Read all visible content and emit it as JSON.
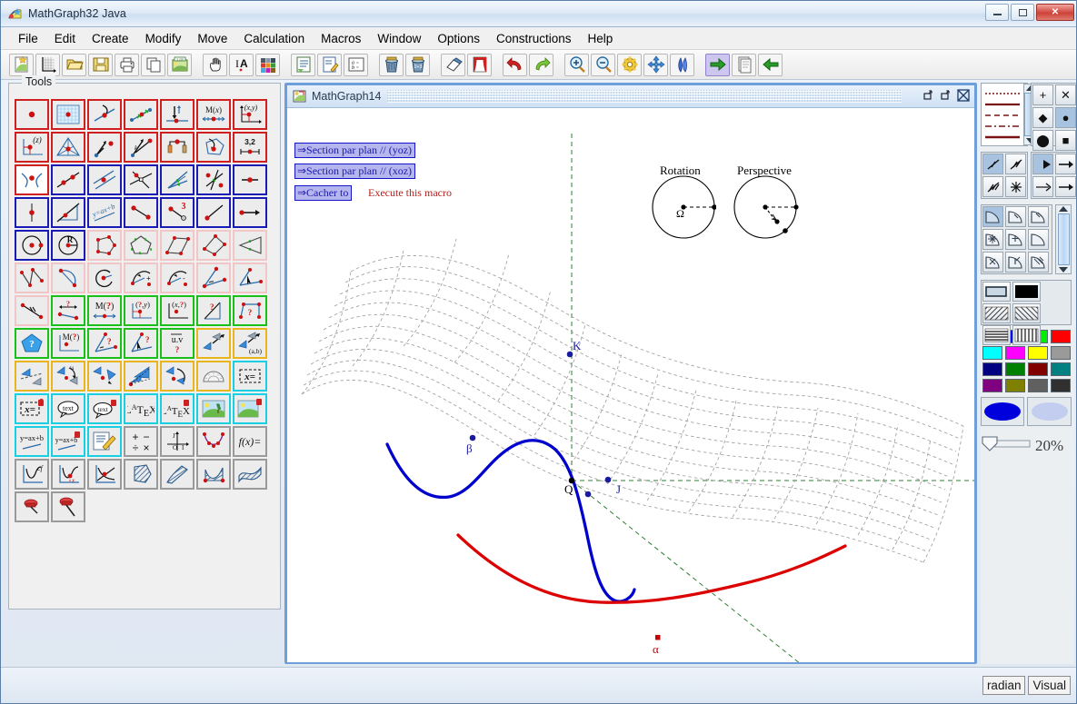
{
  "window": {
    "title": "MathGraph32 Java",
    "icon": "app-icon",
    "minimize": "–",
    "maximize": "□",
    "close": "✕"
  },
  "menubar": {
    "items": [
      {
        "label": "File"
      },
      {
        "label": "Edit"
      },
      {
        "label": "Create"
      },
      {
        "label": "Modify"
      },
      {
        "label": "Move"
      },
      {
        "label": "Calculation"
      },
      {
        "label": "Macros"
      },
      {
        "label": "Window"
      },
      {
        "label": "Options"
      },
      {
        "label": "Constructions"
      },
      {
        "label": "Help"
      }
    ]
  },
  "toolbar": {
    "groups": [
      {
        "buttons": [
          {
            "name": "new-document-icon",
            "selected": false
          },
          {
            "name": "new-graph-icon",
            "selected": false
          },
          {
            "name": "open-folder-icon",
            "selected": false
          },
          {
            "name": "save-floppy-icon",
            "selected": false
          },
          {
            "name": "print-icon",
            "selected": false
          },
          {
            "name": "copy-icon",
            "selected": false
          },
          {
            "name": "export-image-icon",
            "selected": false
          }
        ]
      },
      {
        "buttons": [
          {
            "name": "hand-pan-icon",
            "selected": false
          },
          {
            "name": "text-cursor-icon",
            "selected": false
          },
          {
            "name": "color-palette-icon",
            "selected": false
          }
        ]
      },
      {
        "buttons": [
          {
            "name": "document-list-icon",
            "selected": false
          },
          {
            "name": "edit-note-icon",
            "selected": false
          },
          {
            "name": "formula-abc-icon",
            "selected": false
          }
        ]
      },
      {
        "buttons": [
          {
            "name": "trash-icon",
            "selected": false
          },
          {
            "name": "trash-calc-icon",
            "selected": false
          }
        ]
      },
      {
        "buttons": [
          {
            "name": "eraser-icon",
            "selected": false
          },
          {
            "name": "curtain-icon",
            "selected": false
          }
        ]
      },
      {
        "buttons": [
          {
            "name": "undo-icon",
            "selected": false
          },
          {
            "name": "redo-icon",
            "selected": false
          }
        ]
      },
      {
        "buttons": [
          {
            "name": "zoom-in-icon",
            "selected": false
          },
          {
            "name": "zoom-out-icon",
            "selected": false
          },
          {
            "name": "gear-settings-icon",
            "selected": false
          },
          {
            "name": "move-arrows-icon",
            "selected": false
          },
          {
            "name": "reflect-icon",
            "selected": false
          }
        ]
      },
      {
        "buttons": [
          {
            "name": "step-forward-icon",
            "selected": true
          },
          {
            "name": "pages-icon",
            "selected": false
          },
          {
            "name": "step-back-icon",
            "selected": false
          }
        ]
      }
    ]
  },
  "tools": {
    "legend": "Tools",
    "cells": [
      {
        "name": "tool-free-point",
        "family": "red",
        "selected": false
      },
      {
        "name": "tool-point-on-grid",
        "family": "red",
        "selected": false
      },
      {
        "name": "tool-point-on-line",
        "family": "red",
        "selected": false
      },
      {
        "name": "tool-point-on-segment",
        "family": "red",
        "selected": false
      },
      {
        "name": "tool-point-projection",
        "family": "red",
        "selected": false
      },
      {
        "name": "tool-point-m-of-x",
        "family": "red",
        "selected": false
      },
      {
        "name": "tool-point-xy",
        "family": "red",
        "selected": false
      },
      {
        "name": "tool-point-z",
        "family": "red",
        "selected": false
      },
      {
        "name": "tool-barycenter",
        "family": "red",
        "selected": false
      },
      {
        "name": "tool-vector-point",
        "family": "red",
        "selected": false
      },
      {
        "name": "tool-vector-k",
        "family": "red",
        "selected": false
      },
      {
        "name": "tool-point-between",
        "family": "red",
        "selected": false
      },
      {
        "name": "tool-point-in-polygon",
        "family": "red",
        "selected": false
      },
      {
        "name": "tool-point-coords-32",
        "family": "red",
        "selected": false
      },
      {
        "name": "tool-intersection",
        "family": "red",
        "selected": true
      },
      {
        "name": "tool-line-two-points",
        "family": "blue",
        "selected": false
      },
      {
        "name": "tool-parallel-line",
        "family": "blue",
        "selected": false
      },
      {
        "name": "tool-perpendicular-line",
        "family": "blue",
        "selected": false
      },
      {
        "name": "tool-angle-bisector",
        "family": "blue",
        "selected": false
      },
      {
        "name": "tool-perp-bisector",
        "family": "blue",
        "selected": false
      },
      {
        "name": "tool-segment",
        "family": "blue",
        "selected": false
      },
      {
        "name": "tool-vertical-line",
        "family": "blue",
        "selected": false
      },
      {
        "name": "tool-ray",
        "family": "blue",
        "selected": false
      },
      {
        "name": "tool-line-y-ax-b",
        "family": "blue",
        "selected": false
      },
      {
        "name": "tool-segment-two-pts",
        "family": "blue",
        "selected": false
      },
      {
        "name": "tool-segment-length-3",
        "family": "blue",
        "selected": false
      },
      {
        "name": "tool-half-line",
        "family": "blue",
        "selected": false
      },
      {
        "name": "tool-vector-arrow",
        "family": "blue",
        "selected": false
      },
      {
        "name": "tool-circle-center-point",
        "family": "blue",
        "selected": false
      },
      {
        "name": "tool-circle-radius",
        "family": "blue",
        "selected": false
      },
      {
        "name": "tool-polygon",
        "family": "pink",
        "selected": false
      },
      {
        "name": "tool-regular-polygon",
        "family": "pink",
        "selected": false
      },
      {
        "name": "tool-parallelogram",
        "family": "pink",
        "selected": false
      },
      {
        "name": "tool-square",
        "family": "pink",
        "selected": false
      },
      {
        "name": "tool-isosceles-triangle",
        "family": "pink",
        "selected": false
      },
      {
        "name": "tool-broken-line",
        "family": "pink",
        "selected": false
      },
      {
        "name": "tool-circle-arc-chord",
        "family": "pink",
        "selected": false
      },
      {
        "name": "tool-arc-center",
        "family": "pink",
        "selected": false
      },
      {
        "name": "tool-arc-plus",
        "family": "pink",
        "selected": false
      },
      {
        "name": "tool-arc-minus",
        "family": "pink",
        "selected": false
      },
      {
        "name": "tool-angle-mark",
        "family": "pink",
        "selected": false
      },
      {
        "name": "tool-angle-pick",
        "family": "pink",
        "selected": false
      },
      {
        "name": "tool-tick-mark",
        "family": "pink",
        "selected": false
      },
      {
        "name": "tool-measure-length",
        "family": "green",
        "selected": false
      },
      {
        "name": "tool-measure-m-question",
        "family": "green",
        "selected": false
      },
      {
        "name": "tool-measure-y",
        "family": "green",
        "selected": false
      },
      {
        "name": "tool-measure-x",
        "family": "green",
        "selected": false
      },
      {
        "name": "tool-measure-slope",
        "family": "green",
        "selected": false
      },
      {
        "name": "tool-measure-area",
        "family": "green",
        "selected": false
      },
      {
        "name": "tool-polygon-question",
        "family": "green",
        "selected": false
      },
      {
        "name": "tool-point-m-question",
        "family": "green",
        "selected": false
      },
      {
        "name": "tool-angle-question",
        "family": "green",
        "selected": false
      },
      {
        "name": "tool-angle-pick-question",
        "family": "green",
        "selected": false
      },
      {
        "name": "tool-dot-product",
        "family": "green",
        "selected": false
      },
      {
        "name": "tool-translation",
        "family": "gold",
        "selected": false
      },
      {
        "name": "tool-translation-ab",
        "family": "gold",
        "selected": false
      },
      {
        "name": "tool-reflection-line",
        "family": "gold",
        "selected": false
      },
      {
        "name": "tool-rotation-quarter",
        "family": "gold",
        "selected": false
      },
      {
        "name": "tool-point-symmetry",
        "family": "gold",
        "selected": false
      },
      {
        "name": "tool-homothety",
        "family": "gold",
        "selected": false
      },
      {
        "name": "tool-rotation",
        "family": "gold",
        "selected": false
      },
      {
        "name": "tool-protractor",
        "family": "gold",
        "selected": false
      },
      {
        "name": "tool-display-value",
        "family": "cyan",
        "selected": false
      },
      {
        "name": "tool-display-value-locked",
        "family": "cyan",
        "selected": false
      },
      {
        "name": "tool-text",
        "family": "cyan",
        "selected": false
      },
      {
        "name": "tool-text-locked",
        "family": "cyan",
        "selected": false
      },
      {
        "name": "tool-latex",
        "family": "cyan",
        "selected": false
      },
      {
        "name": "tool-latex-locked",
        "family": "cyan",
        "selected": false
      },
      {
        "name": "tool-image",
        "family": "cyan",
        "selected": false
      },
      {
        "name": "tool-image-locked",
        "family": "cyan",
        "selected": false
      },
      {
        "name": "tool-linear-function",
        "family": "cyan",
        "selected": false
      },
      {
        "name": "tool-linear-function-locked",
        "family": "cyan",
        "selected": false
      },
      {
        "name": "tool-edit-note",
        "family": "cyan",
        "selected": false
      },
      {
        "name": "tool-operations",
        "family": "gray",
        "selected": false
      },
      {
        "name": "tool-axes",
        "family": "gray",
        "selected": false
      },
      {
        "name": "tool-point-series",
        "family": "gray",
        "selected": false
      },
      {
        "name": "tool-function-fx",
        "family": "gray",
        "selected": false
      },
      {
        "name": "tool-curve-plot",
        "family": "gray",
        "selected": false
      },
      {
        "name": "tool-curve-point",
        "family": "gray",
        "selected": false
      },
      {
        "name": "tool-tangent",
        "family": "gray",
        "selected": false
      },
      {
        "name": "tool-fill-polygon",
        "family": "gray",
        "selected": false
      },
      {
        "name": "tool-fill-region",
        "family": "gray",
        "selected": false
      },
      {
        "name": "tool-fill-under-curve",
        "family": "gray",
        "selected": false
      },
      {
        "name": "tool-fill-between-curves",
        "family": "gray",
        "selected": false
      },
      {
        "name": "tool-pin-flat",
        "family": "gray",
        "selected": false
      },
      {
        "name": "tool-pin-upright",
        "family": "gray",
        "selected": false
      }
    ]
  },
  "graph_window": {
    "title": "MathGraph14",
    "icon": "graph-doc-icon",
    "controls": [
      {
        "name": "restore-small-button",
        "glyph": "⇱"
      },
      {
        "name": "maximize-button",
        "glyph": "⇱"
      },
      {
        "name": "close-button",
        "glyph": "✕"
      }
    ],
    "macros": [
      {
        "label": "⇒Section par plan // (yoz)",
        "boxed": true
      },
      {
        "label": "⇒Section par plan // (xoz)",
        "boxed": true
      },
      {
        "label": "⇒Cacher to",
        "boxed": true
      }
    ],
    "tooltip": "Execute this macro",
    "widgets": [
      {
        "label": "Rotation",
        "center_label": "Ω"
      },
      {
        "label": "Perspective",
        "center_label": ""
      }
    ],
    "points": [
      {
        "label": "K",
        "color": "#1a1a9e"
      },
      {
        "label": "Q",
        "color": "#000000"
      },
      {
        "label": "J",
        "color": "#1a1a9e"
      },
      {
        "label": "β",
        "color": "#1a1a9e"
      },
      {
        "label": "α",
        "color": "#cc0000"
      }
    ],
    "curves": [
      {
        "name": "blue-section-curve",
        "color": "#0000cc"
      },
      {
        "name": "red-section-curve",
        "color": "#dd0000"
      }
    ],
    "surface": {
      "name": "saddle-surface-mesh",
      "color": "#9a9a9a",
      "style": "dashed-wireframe"
    },
    "axes": {
      "name": "axes-dashed",
      "color": "#2e7d32",
      "style": "dashed"
    }
  },
  "right_panel": {
    "line_styles": [
      "dotted",
      "solid",
      "dashed",
      "dash-dot",
      "solid-thick"
    ],
    "point_styles": [
      {
        "name": "plus-marker",
        "glyph": "+",
        "selected": false
      },
      {
        "name": "cross-marker",
        "glyph": "✕",
        "selected": false
      },
      {
        "name": "diamond-marker",
        "glyph": "◆",
        "selected": false
      },
      {
        "name": "dot-marker",
        "glyph": "●",
        "selected": true
      },
      {
        "name": "large-dot-marker",
        "glyph": "⬤",
        "selected": false
      },
      {
        "name": "square-marker",
        "glyph": "■",
        "selected": false
      }
    ],
    "tick_marks": [
      {
        "name": "single-tick",
        "selected": true
      },
      {
        "name": "double-tick",
        "selected": false
      },
      {
        "name": "triple-tick",
        "selected": false
      },
      {
        "name": "star-tick",
        "selected": false
      }
    ],
    "arrow_styles": [
      {
        "name": "filled-arrow",
        "selected": true
      },
      {
        "name": "open-arrow-1",
        "selected": false
      },
      {
        "name": "thin-arrow",
        "selected": false
      },
      {
        "name": "plain-arrow",
        "selected": false
      }
    ],
    "angle_marks": [
      {
        "name": "angle-arc-plain",
        "selected": true
      },
      {
        "name": "angle-arc-tick",
        "selected": false
      },
      {
        "name": "angle-arc-double-tick",
        "selected": false
      },
      {
        "name": "angle-arc-star",
        "selected": false
      },
      {
        "name": "angle-arc-plus",
        "selected": false
      },
      {
        "name": "angle-sector-fill",
        "selected": false
      },
      {
        "name": "angle-arc-alt-1",
        "selected": false
      },
      {
        "name": "angle-arc-alt-2",
        "selected": false
      },
      {
        "name": "angle-arc-alt-3",
        "selected": false
      }
    ],
    "fill_patterns": [
      {
        "name": "fill-outline",
        "selected": false
      },
      {
        "name": "fill-solid-black",
        "selected": false
      },
      {
        "name": "fill-hatch-right",
        "selected": false
      },
      {
        "name": "fill-hatch-left",
        "selected": false
      },
      {
        "name": "fill-horizontal-lines",
        "selected": false
      },
      {
        "name": "fill-vertical-lines",
        "selected": false
      }
    ],
    "colors": [
      "#000000",
      "#0000ff",
      "#00ee00",
      "#ff0000",
      "#00ffff",
      "#ff00ff",
      "#ffff00",
      "#9a9a9a",
      "#000080",
      "#008000",
      "#800000",
      "#008080",
      "#800080",
      "#808000",
      "#606060",
      "#303030"
    ],
    "preview": [
      {
        "name": "opaque-ellipse-preview",
        "color": "#0000dd"
      },
      {
        "name": "transparent-ellipse-preview",
        "color": "#c3cdf0"
      }
    ],
    "opacity": {
      "label": "20%",
      "value": 20
    }
  },
  "statusbar": {
    "buttons": [
      {
        "label": "radian",
        "name": "angle-unit-button"
      },
      {
        "label": "Visual",
        "name": "visual-mode-button"
      }
    ]
  }
}
